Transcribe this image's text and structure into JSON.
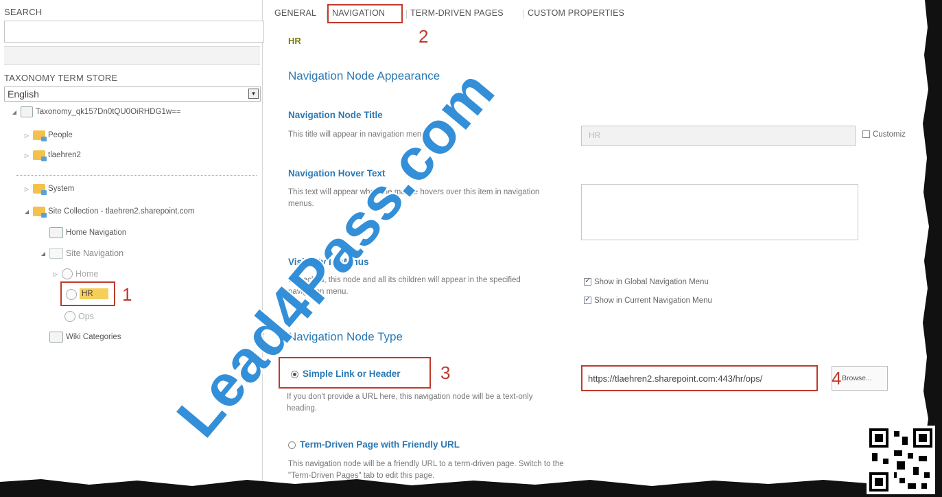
{
  "left_pane": {
    "search_label": "SEARCH",
    "search_placeholder": "",
    "term_store_label": "TAXONOMY TERM STORE",
    "language": "English",
    "tree": {
      "root": "Taxonomy_qk157Dn0tQU0OiRHDG1w==",
      "people": "People",
      "tlaehren2": "tlaehren2",
      "system": "System",
      "site_collection": "Site Collection - tlaehren2.sharepoint.com",
      "home_navigation": "Home Navigation",
      "site_navigation": "Site Navigation",
      "home": "Home",
      "hr": "HR",
      "ops": "Ops",
      "wiki_categories": "Wiki Categories"
    },
    "annotation_1": "1"
  },
  "tabs": {
    "general": "GENERAL",
    "navigation": "NAVIGATION",
    "term_driven_pages": "TERM-DRIVEN PAGES",
    "custom_properties": "CUSTOM PROPERTIES"
  },
  "annotation_2": "2",
  "term_name": "HR",
  "section_appearance": "Navigation Node Appearance",
  "node_title": {
    "title": "Navigation Node Title",
    "desc": "This title will appear in navigation menus.",
    "value": "HR",
    "customize_label": "Customiz"
  },
  "hover_text": {
    "title": "Navigation Hover Text",
    "desc": "This text will appear when the mouse hovers over this item in navigation menus.",
    "value": ""
  },
  "visibility": {
    "title": "Visibility In Menus",
    "desc": "If checked, this node and all its children will appear in the specified navigation menu.",
    "global_label": "Show in Global Navigation Menu",
    "current_label": "Show in Current Navigation Menu",
    "global_checked": true,
    "current_checked": true
  },
  "section_type": "Navigation Node Type",
  "simple_link": {
    "label": "Simple Link or Header",
    "desc": "If you don't provide a URL here, this navigation node will be a text-only heading.",
    "url": "https://tlaehren2.sharepoint.com:443/hr/ops/",
    "browse": "Browse...",
    "annotation_3": "3",
    "annotation_4": "4"
  },
  "term_driven": {
    "label": "Term-Driven Page with Friendly URL",
    "desc": "This navigation node will be a friendly URL to a term-driven page. Switch to the \"Term-Driven Pages\" tab to edit this page."
  },
  "watermark": "Lead4Pass.com",
  "colors": {
    "accent_blue": "#2b79b5",
    "annotation_red": "#c0392b",
    "selected_term": "#f6cf5a"
  }
}
